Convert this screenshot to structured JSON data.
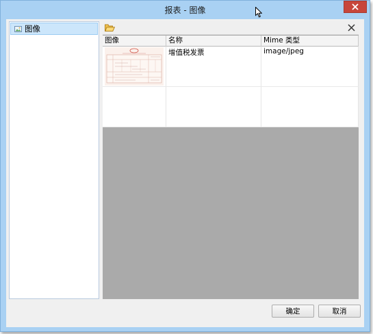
{
  "window": {
    "title": "报表 - 图像"
  },
  "left_panel": {
    "tree_items": [
      {
        "label": "图像",
        "selected": true
      }
    ]
  },
  "right_panel": {
    "toolbar": {
      "open_icon": "folder-open-icon",
      "remove_icon": "close-x-icon"
    },
    "grid": {
      "columns": [
        "图像",
        "名称",
        "Mime 类型"
      ],
      "rows": [
        {
          "image": "invoice-thumbnail",
          "name": "增值税发票",
          "mime": "image/jpeg"
        },
        {
          "image": "",
          "name": "",
          "mime": ""
        }
      ]
    }
  },
  "buttons": {
    "ok_label": "确定",
    "cancel_label": "取消"
  },
  "colors": {
    "titlebar": "#a9d1f3",
    "close_button": "#c7463b",
    "selected_item": "#cce6fb",
    "empty_area": "#aaaaaa"
  }
}
